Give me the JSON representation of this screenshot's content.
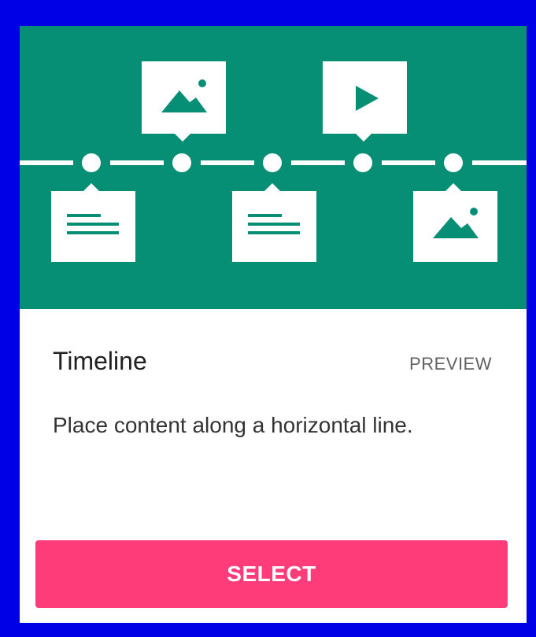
{
  "card": {
    "title": "Timeline",
    "preview_label": "PREVIEW",
    "description": "Place content along a horizontal line.",
    "select_label": "SELECT"
  },
  "colors": {
    "banner": "#068f74",
    "button": "#ff3c7a",
    "border": "#0000e6"
  },
  "icons": {
    "top": [
      "image-icon",
      "play-icon"
    ],
    "bottom": [
      "text-icon",
      "text-icon",
      "image-icon"
    ]
  }
}
